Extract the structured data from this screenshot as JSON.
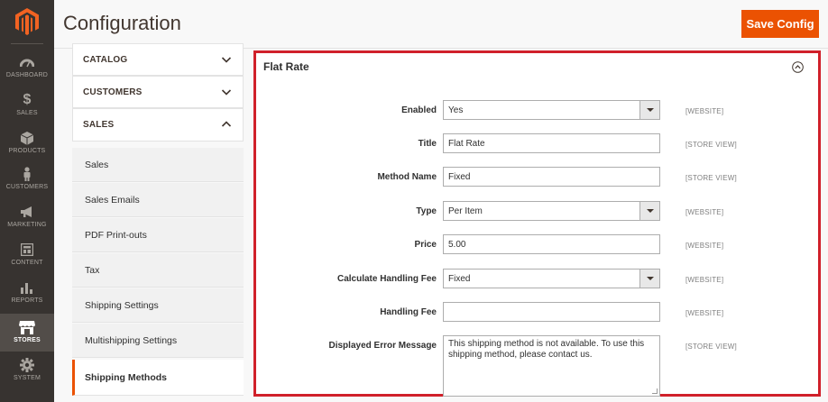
{
  "app": {
    "page_title": "Configuration",
    "save_label": "Save Config",
    "accent_color": "#eb5202",
    "highlight_color": "#d0202a"
  },
  "admin_menu": [
    {
      "label": "DASHBOARD",
      "icon": "dashboard-icon"
    },
    {
      "label": "SALES",
      "icon": "dollar-icon"
    },
    {
      "label": "PRODUCTS",
      "icon": "box-icon"
    },
    {
      "label": "CUSTOMERS",
      "icon": "person-icon"
    },
    {
      "label": "MARKETING",
      "icon": "megaphone-icon"
    },
    {
      "label": "CONTENT",
      "icon": "content-icon"
    },
    {
      "label": "REPORTS",
      "icon": "bar-chart-icon"
    },
    {
      "label": "STORES",
      "icon": "store-icon",
      "active": true
    },
    {
      "label": "SYSTEM",
      "icon": "gear-icon"
    }
  ],
  "config_tabs": {
    "sections": [
      {
        "label": "CATALOG",
        "state": "collapsed"
      },
      {
        "label": "CUSTOMERS",
        "state": "collapsed"
      },
      {
        "label": "SALES",
        "state": "expanded"
      }
    ],
    "sales_items": [
      {
        "label": "Sales"
      },
      {
        "label": "Sales Emails"
      },
      {
        "label": "PDF Print-outs"
      },
      {
        "label": "Tax"
      },
      {
        "label": "Shipping Settings"
      },
      {
        "label": "Multishipping Settings"
      },
      {
        "label": "Shipping Methods",
        "active": true
      }
    ]
  },
  "fieldset": {
    "title": "Flat Rate",
    "rows": [
      {
        "label": "Enabled",
        "type": "select",
        "value": "Yes",
        "scope": "[WEBSITE]"
      },
      {
        "label": "Title",
        "type": "text",
        "value": "Flat Rate",
        "scope": "[STORE VIEW]"
      },
      {
        "label": "Method Name",
        "type": "text",
        "value": "Fixed",
        "scope": "[STORE VIEW]"
      },
      {
        "label": "Type",
        "type": "select",
        "value": "Per Item",
        "scope": "[WEBSITE]"
      },
      {
        "label": "Price",
        "type": "text",
        "value": "5.00",
        "scope": "[WEBSITE]"
      },
      {
        "label": "Calculate Handling Fee",
        "type": "select",
        "value": "Fixed",
        "scope": "[WEBSITE]"
      },
      {
        "label": "Handling Fee",
        "type": "text",
        "value": "",
        "scope": "[WEBSITE]"
      },
      {
        "label": "Displayed Error Message",
        "type": "textarea",
        "value": "This shipping method is not available. To use this shipping method, please contact us.",
        "scope": "[STORE VIEW]"
      }
    ]
  }
}
